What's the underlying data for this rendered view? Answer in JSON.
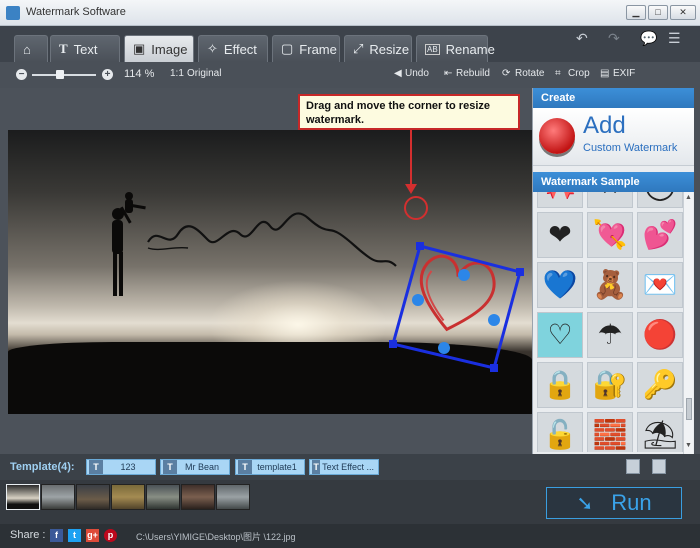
{
  "window": {
    "title": "Watermark Software"
  },
  "tabs": [
    {
      "label": "",
      "icon": "home-icon"
    },
    {
      "label": "Text",
      "icon": "text-icon"
    },
    {
      "label": "Image",
      "icon": "image-icon",
      "active": true
    },
    {
      "label": "Effect",
      "icon": "magic-wand-icon"
    },
    {
      "label": "Frame",
      "icon": "frame-icon"
    },
    {
      "label": "Resize",
      "icon": "resize-icon"
    },
    {
      "label": "Rename",
      "icon": "rename-icon"
    }
  ],
  "toolbar": {
    "zoom": "114 %",
    "original": "Original",
    "undo": "Undo",
    "rebuild": "Rebuild",
    "rotate": "Rotate",
    "crop": "Crop",
    "exif": "EXIF"
  },
  "canvas": {
    "callout": "Drag and move the corner to resize watermark."
  },
  "panel": {
    "create_header": "Create",
    "add_title": "Add",
    "add_subtitle": "Custom Watermark",
    "sample_header": "Watermark Sample"
  },
  "samples": [
    {
      "name": "heart-ribbon-icon",
      "glyph": "🎀"
    },
    {
      "name": "red-x-icon",
      "glyph": "✖"
    },
    {
      "name": "blue-ring-icon",
      "glyph": "◯"
    },
    {
      "name": "glossy-heart-icon",
      "glyph": "❤"
    },
    {
      "name": "heart-arrow-icon",
      "glyph": "💘"
    },
    {
      "name": "winged-heart-icon",
      "glyph": "💕"
    },
    {
      "name": "blue-heart-icon",
      "glyph": "💙"
    },
    {
      "name": "love-bear-icon",
      "glyph": "🧸"
    },
    {
      "name": "love-letter-icon",
      "glyph": "💌"
    },
    {
      "name": "outline-heart-icon",
      "glyph": "♡"
    },
    {
      "name": "umbrella-icon",
      "glyph": "☂"
    },
    {
      "name": "red-button-icon",
      "glyph": "🔴"
    },
    {
      "name": "gold-lock-icon",
      "glyph": "🔒"
    },
    {
      "name": "blue-lock-icon",
      "glyph": "🔐"
    },
    {
      "name": "key-icon",
      "glyph": "🔑"
    },
    {
      "name": "silver-lock-icon",
      "glyph": "🔓"
    },
    {
      "name": "brick-wall-icon",
      "glyph": "🧱"
    },
    {
      "name": "beach-umbrella-icon",
      "glyph": "⛱"
    }
  ],
  "templates": {
    "label": "Template(4):",
    "items": [
      "123",
      "Mr Bean",
      "template1",
      "Text Effect ..."
    ]
  },
  "run_label": "Run",
  "status": {
    "share": "Share :",
    "path": "C:\\Users\\YIMIGE\\Desktop\\图片 \\122.jpg"
  },
  "colors": {
    "accent": "#3aa3ea",
    "callout_border": "#c62828",
    "selection_frame": "#1a2fe0"
  }
}
